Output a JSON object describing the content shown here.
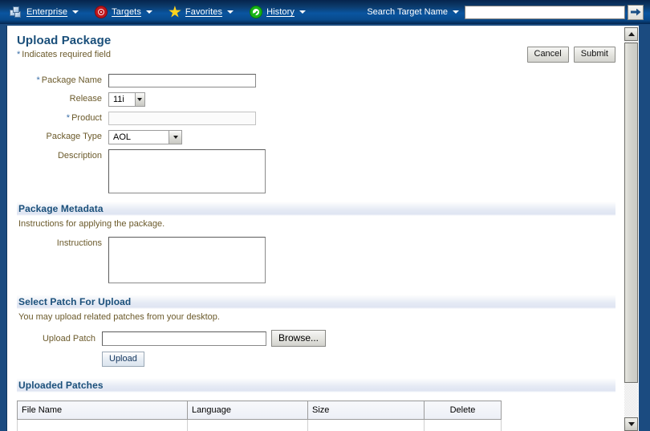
{
  "topbar": {
    "menus": [
      {
        "label": "Enterprise",
        "icon": "enterprise-cubes-icon"
      },
      {
        "label": "Targets",
        "icon": "target-bullseye-icon"
      },
      {
        "label": "Favorites",
        "icon": "star-icon"
      },
      {
        "label": "History",
        "icon": "green-check-circle-icon"
      }
    ],
    "search_label": "Search Target Name",
    "search_value": "",
    "search_placeholder": "",
    "go_icon": "right-arrow-icon"
  },
  "page": {
    "title": "Upload Package",
    "required_marker": "*",
    "required_note": "Indicates required field",
    "cancel_label": "Cancel",
    "submit_label": "Submit"
  },
  "form": {
    "package_name": {
      "label": "Package Name",
      "required": "*",
      "value": "",
      "placeholder": ""
    },
    "release": {
      "label": "Release",
      "value": "11i"
    },
    "product": {
      "label": "Product",
      "required": "*",
      "value": "",
      "placeholder": ""
    },
    "package_type": {
      "label": "Package Type",
      "value": "AOL"
    },
    "description": {
      "label": "Description",
      "value": "",
      "placeholder": ""
    }
  },
  "metadata": {
    "section_title": "Package Metadata",
    "note": "Instructions for applying the package.",
    "instructions": {
      "label": "Instructions",
      "value": "",
      "placeholder": ""
    }
  },
  "select_patch": {
    "section_title": "Select Patch For Upload",
    "note": "You may upload related patches from your desktop.",
    "upload_patch_label": "Upload Patch",
    "upload_patch_value": "",
    "browse_label": "Browse...",
    "upload_label": "Upload"
  },
  "uploaded_patches": {
    "section_title": "Uploaded Patches",
    "columns": [
      "File Name",
      "Language",
      "Size",
      "Delete"
    ],
    "rows": [
      {
        "file_name": "",
        "language": "",
        "size": "",
        "delete": ""
      }
    ]
  },
  "scrollbar": {
    "up_icon": "scroll-up-arrow-icon",
    "down_icon": "scroll-down-arrow-icon"
  }
}
